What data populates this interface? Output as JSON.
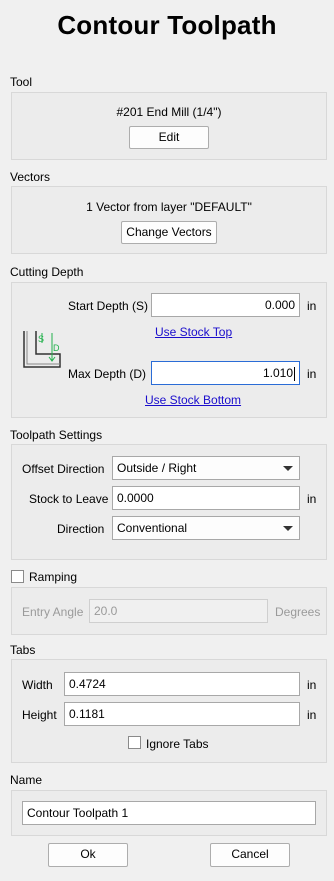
{
  "title": "Contour Toolpath",
  "tool": {
    "section": "Tool",
    "name": "#201 End Mill (1/4\")",
    "edit_label": "Edit"
  },
  "vectors": {
    "section": "Vectors",
    "summary": "1 Vector from layer \"DEFAULT\"",
    "change_label": "Change Vectors"
  },
  "cutting_depth": {
    "section": "Cutting Depth",
    "start_label": "Start Depth (S)",
    "start_value": "0.000",
    "start_unit": "in",
    "use_stock_top": "Use Stock Top",
    "max_label": "Max Depth (D)",
    "max_value": "1.010",
    "max_unit": "in",
    "use_stock_bottom": "Use Stock Bottom",
    "diagram_s": "S",
    "diagram_d": "D"
  },
  "toolpath_settings": {
    "section": "Toolpath Settings",
    "offset_label": "Offset Direction",
    "offset_value": "Outside / Right",
    "stock_label": "Stock to Leave",
    "stock_value": "0.0000",
    "stock_unit": "in",
    "direction_label": "Direction",
    "direction_value": "Conventional"
  },
  "ramping": {
    "label": "Ramping",
    "checked": false,
    "angle_label": "Entry Angle",
    "angle_value": "20.0",
    "angle_unit": "Degrees"
  },
  "tabs": {
    "section": "Tabs",
    "width_label": "Width",
    "width_value": "0.4724",
    "width_unit": "in",
    "height_label": "Height",
    "height_value": "0.1181",
    "height_unit": "in",
    "ignore_label": "Ignore Tabs",
    "ignore_checked": false
  },
  "name": {
    "section": "Name",
    "value": "Contour Toolpath 1"
  },
  "footer": {
    "ok_label": "Ok",
    "cancel_label": "Cancel"
  },
  "colors": {
    "diagram_green": "#22b14c",
    "link": "#1a0dcc",
    "focus": "#2a6cd6"
  }
}
